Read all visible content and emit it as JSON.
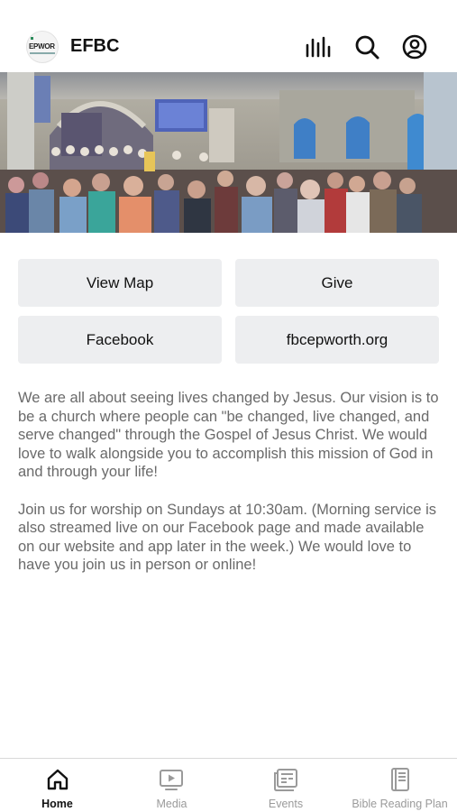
{
  "app": {
    "title": "EFBC",
    "logo_text": "EPWOR"
  },
  "header_icons": [
    "audio-bars-icon",
    "search-icon",
    "account-icon"
  ],
  "buttons": {
    "view_map": "View Map",
    "give": "Give",
    "facebook": "Facebook",
    "website": "fbcepworth.org"
  },
  "description": {
    "paragraph_1": "We are all about seeing lives changed by Jesus. Our vision is to be a church where people can \"be changed, live changed, and serve changed\" through the Gospel of Jesus Christ. We would love to walk alongside you to accomplish this mission of God in and through your life!",
    "paragraph_2": "Join us for worship on Sundays at 10:30am. (Morning service is also streamed live on our Facebook page and made available on our website and app later in the week.) We would love to have you join us in person or online!"
  },
  "tabs": [
    {
      "label": "Home",
      "icon": "home-icon",
      "active": true
    },
    {
      "label": "Media",
      "icon": "media-icon",
      "active": false
    },
    {
      "label": "Events",
      "icon": "events-icon",
      "active": false
    },
    {
      "label": "Bible Reading Plan",
      "icon": "book-icon",
      "active": false
    }
  ],
  "colors": {
    "button_bg": "#edeef0",
    "text_muted": "#6a6a6a",
    "tab_inactive": "#9a9a9a"
  }
}
